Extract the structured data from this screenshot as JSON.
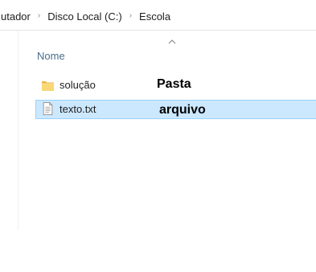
{
  "breadcrumb": {
    "items": [
      "utador",
      "Disco Local (C:)",
      "Escola"
    ],
    "separator": "›"
  },
  "columns": {
    "name_header": "Nome",
    "sort_direction": "ascending"
  },
  "files": [
    {
      "name": "solução",
      "icon": "folder-icon",
      "annotation": "Pasta",
      "selected": false
    },
    {
      "name": "texto.txt",
      "icon": "text-file-icon",
      "annotation": "arquivo",
      "selected": true
    }
  ],
  "colors": {
    "selection_bg": "#cce8ff",
    "selection_border": "#99d1ff",
    "header_text": "#4a6d8c",
    "folder_yellow": "#f8d775"
  }
}
